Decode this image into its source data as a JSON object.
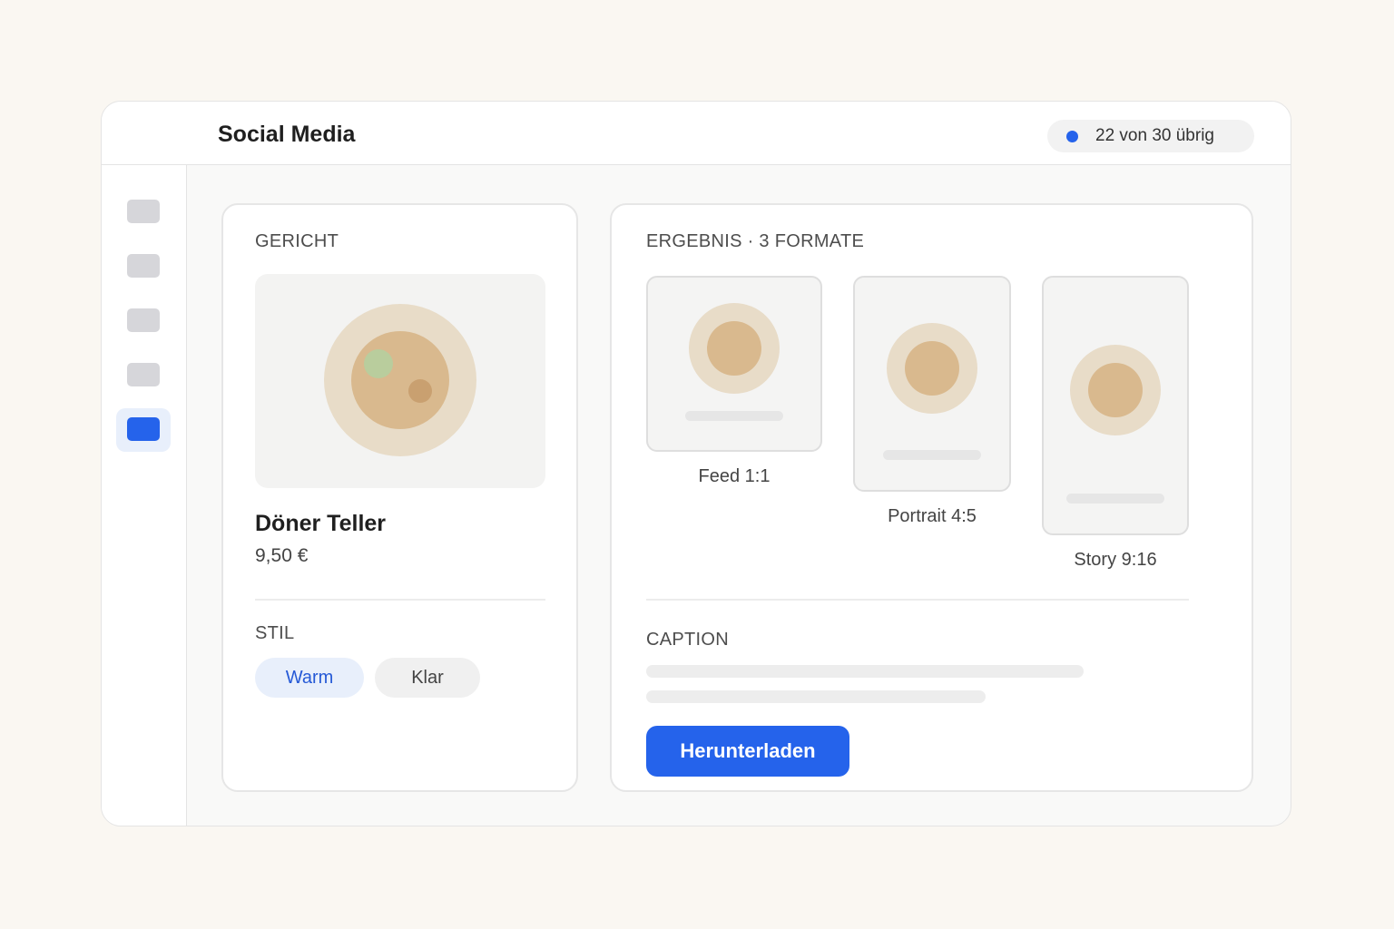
{
  "header": {
    "title": "Social Media",
    "quota_text": "22 von 30 übrig",
    "quota_dot_color": "#2563eb"
  },
  "sidebar": {
    "items": [
      {
        "icon": "nav-placeholder-icon",
        "active": false
      },
      {
        "icon": "nav-placeholder-icon",
        "active": false
      },
      {
        "icon": "nav-placeholder-icon",
        "active": false
      },
      {
        "icon": "nav-placeholder-icon",
        "active": false
      },
      {
        "icon": "nav-placeholder-icon",
        "active": true
      }
    ]
  },
  "dish_panel": {
    "section_label": "GERICHT",
    "dish_name": "Döner Teller",
    "price": "9,50 €",
    "style_label": "STIL",
    "styles": [
      {
        "label": "Warm",
        "selected": true
      },
      {
        "label": "Klar",
        "selected": false
      }
    ]
  },
  "result_panel": {
    "section_label": "ERGEBNIS · 3 FORMATE",
    "formats": [
      {
        "label": "Feed 1:1"
      },
      {
        "label": "Portrait 4:5"
      },
      {
        "label": "Story 9:16"
      }
    ],
    "caption_label": "CAPTION",
    "download_label": "Herunterladen"
  },
  "colors": {
    "accent": "#2563eb",
    "plate": "#e8dcc8",
    "food": "#d9b98e",
    "garnish_green": "#b5cf9f",
    "garnish_brown": "#c9a070"
  }
}
